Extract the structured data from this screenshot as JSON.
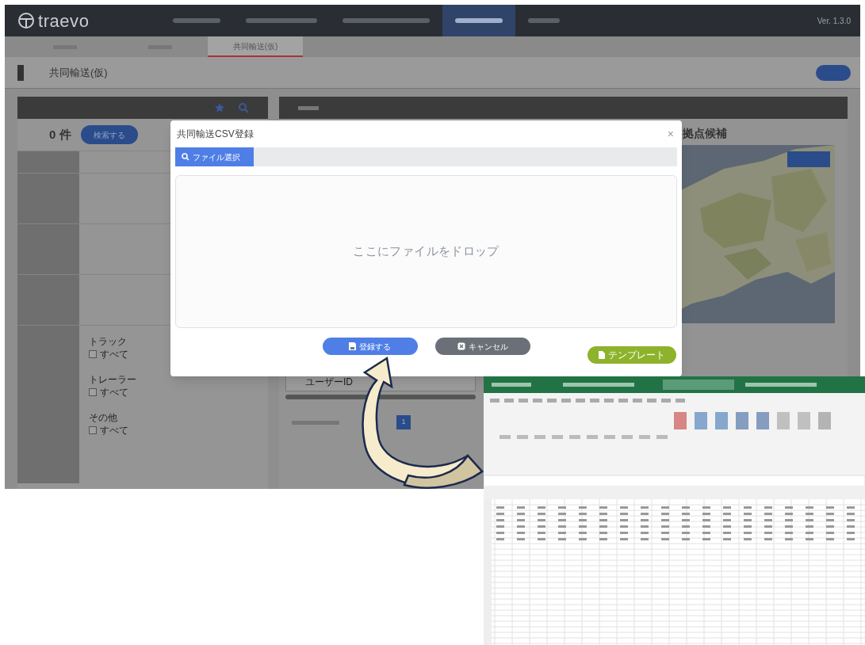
{
  "background_app": {
    "logo": "traevo",
    "version": "Ver. 1.3.0",
    "nav_tabs": [
      {
        "selected": false
      },
      {
        "selected": false
      },
      {
        "selected": false
      },
      {
        "selected": true
      },
      {
        "selected": false
      }
    ],
    "page_tabs": [
      {
        "selected": false
      },
      {
        "selected": false
      },
      {
        "label": "共同輸送(仮)",
        "selected": true
      }
    ],
    "page_title": "共同輸送(仮)",
    "result_count": "0 件",
    "search_button": "検索する",
    "filter_groups": [
      {
        "label": "トラック",
        "all": "すべて",
        "checked": false
      },
      {
        "label": "トレーラー",
        "all": "すべて",
        "checked": false
      },
      {
        "label": "その他",
        "all": "すべて",
        "checked": false
      }
    ],
    "map_title": "拠点候補",
    "table_header": "ユーザーID",
    "pagination_current": "1"
  },
  "dialog": {
    "title": "共同輸送CSV登録",
    "close": "×",
    "file_button": "ファイル選択",
    "drop_hint": "ここにファイルをドロップ",
    "buttons": [
      {
        "label": "登録する",
        "kind": "primary"
      },
      {
        "label": "キャンセル",
        "kind": "secondary"
      }
    ],
    "template_button": "テンプレート"
  }
}
